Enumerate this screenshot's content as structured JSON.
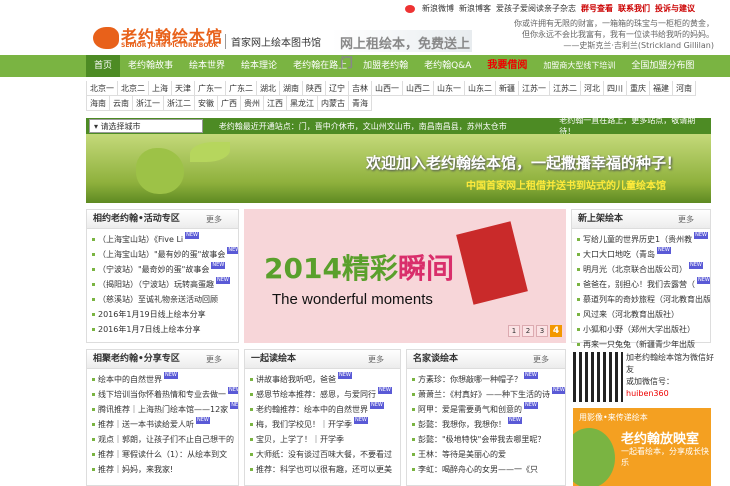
{
  "header": {
    "logo_cn": "老约翰绘本馆",
    "logo_en": "SENIOR JOHN PICTURE BOOK",
    "tagline": "首家网上绘本图书馆",
    "slogan": "网上租绘本，免费送上门",
    "toplinks": [
      "新浪微博",
      "新浪博客",
      "爱孩子爱阅读亲子杂志",
      "群号查看",
      "联系我们",
      "投诉与建议"
    ],
    "quote": [
      "你或许拥有无限的财富，一箱箱的珠宝与一柜柜的黄金，",
      "但你永远不会比我富有，我有一位读书给我听的妈妈。",
      "——史斯克兰·吉利兰(Strickland Gillilan)"
    ]
  },
  "nav": [
    "首页",
    "老约翰故事",
    "绘本世界",
    "绘本理论",
    "老约翰在路上",
    "加盟老约翰",
    "老约翰Q&A",
    "我要借阅",
    "加盟商大型线下培训",
    "全国加盟分布图"
  ],
  "cities": [
    "北京一",
    "北京二",
    "上海",
    "天津",
    "广东一",
    "广东二",
    "湖北",
    "湖南",
    "陕西",
    "辽宁",
    "吉林",
    "山西一",
    "山西二",
    "山东一",
    "山东二",
    "新疆",
    "江苏一",
    "江苏二",
    "河北",
    "四川",
    "重庆",
    "福建",
    "河南",
    "海南",
    "云南",
    "浙江一",
    "浙江二",
    "安徽",
    "广西",
    "贵州",
    "江西",
    "黑龙江",
    "内蒙古",
    "青海"
  ],
  "select_bar": {
    "select_label": "请选择城市",
    "ticker": "老约翰最近开通站点：门，晋中介休市，文山州文山市，南昌南昌县，苏州太仓市",
    "right": "老约翰一直在路上，更多站点，敬请期待！"
  },
  "banner": {
    "line1": "欢迎加入老约翰绘本馆，一起撒播幸福的种子！",
    "line2": "中国首家网上租借并送书到站式的儿童绘本馆"
  },
  "box_left1": {
    "title": "相约老约翰•活动专区",
    "more": "更多",
    "items": [
      "（上海宝山站）《Five Li",
      "（上海宝山站）\"最有妙的蛋\"故事会",
      "（宁波站）\"最奇妙的蛋\"故事会",
      "（揭阳站）（宁波站）玩转高蛋趣",
      "（慈溪站）至诚礼物亲送活动回顾",
      "2016年1月19日线上绘本分享",
      "2016年1月7日线上绘本分享"
    ]
  },
  "center": {
    "title_a": "2014精彩",
    "title_b": "瞬间",
    "en": "The wonderful moments",
    "pages": [
      "1",
      "2",
      "3",
      "4"
    ]
  },
  "box_right1": {
    "title": "新上架绘本",
    "more": "更多",
    "items": [
      "写给儿童的世界历史1（贵州教",
      "大口大口地吃（青岛",
      "明月光（北京联合出版公司）",
      "爸爸在，别担心！我们去露营（",
      "慕道列车的奇妙旅程（河北教育出版",
      "风过来（河北教育出版社）",
      "小狐和小野（郑州大学出版社）",
      "再来一只兔兔（新疆青少年出版"
    ]
  },
  "box_left2": {
    "title": "相聚老约翰•分享专区",
    "more": "更多",
    "items": [
      "绘本中的自然世界",
      "线下培训当你怀着热情和专业去做一",
      "腾讯推荐｜上海热门绘本馆——12家",
      "推荐｜送一本书读给爱人听",
      "观点｜郭朗，让孩子们不止自己想干的",
      "推荐｜寒假读什么（1）：从绘本到文",
      "推荐｜妈妈，来我家!"
    ]
  },
  "box_mid2": {
    "title": "一起读绘本",
    "more": "更多",
    "items": [
      "讲故事给我听吧，爸爸",
      "感恩节绘本推荐：感恩，与爱同行",
      "老约翰推荐：绘本中的自然世界",
      "梅，我们学校见！｜开学季",
      "宝贝，上学了！｜开学季",
      "大师纸：没有谈过百味大餐，不要看过",
      "推荐：科学也可以很有趣，还可以更美"
    ]
  },
  "box_mid3": {
    "title": "名家谈绘本",
    "more": "更多",
    "items": [
      "方素珍：你想敲哪一种帽子？",
      "萧萧兰：《村真好》——种下生活的诗",
      "阿甲：爱是需要勇气和创意的",
      "彭懿：我想你，我想你！",
      "彭懿：\"极地特快\"会带我去哪里呢？",
      "王林：等待是美丽心的爱",
      "李虹：喝醉舟心的女男——一《只"
    ]
  },
  "qr": {
    "line1": "加老约翰绘本馆为微信好友",
    "line2": "或加微信号：",
    "account": "huiben360"
  },
  "promo": {
    "p1": "用影像•来传递绘本",
    "p2": "老约翰放映室",
    "p3": "一起看绘本，分享成长快乐"
  },
  "colors": {
    "brand_green": "#7ab442",
    "dark_green": "#4d8b24",
    "orange": "#e8611a"
  }
}
